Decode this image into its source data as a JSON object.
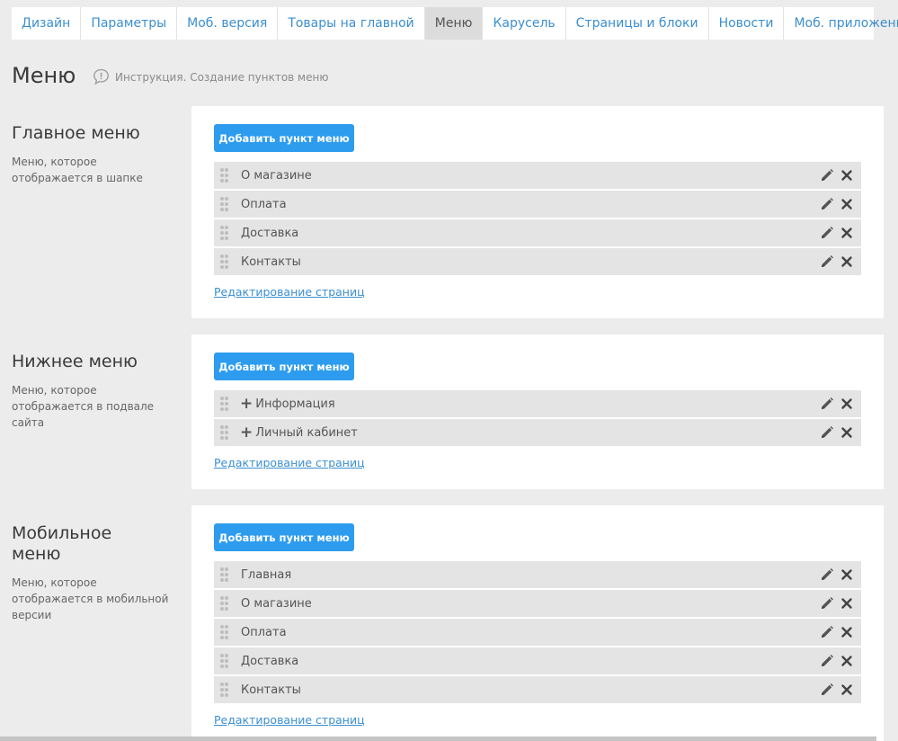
{
  "tabs": [
    {
      "label": "Дизайн",
      "active": false
    },
    {
      "label": "Параметры",
      "active": false
    },
    {
      "label": "Моб. версия",
      "active": false
    },
    {
      "label": "Товары на главной",
      "active": false
    },
    {
      "label": "Меню",
      "active": true
    },
    {
      "label": "Карусель",
      "active": false
    },
    {
      "label": "Страницы и блоки",
      "active": false
    },
    {
      "label": "Новости",
      "active": false
    },
    {
      "label": "Моб. приложение",
      "active": false
    }
  ],
  "page": {
    "title": "Меню",
    "instruction": "Инструкция. Создание пунктов меню"
  },
  "colors": {
    "accent": "#2d9cef",
    "link": "#3b8fd0",
    "background": "#ececec",
    "item_bg": "#e4e4e4"
  },
  "sections": [
    {
      "title": "Главное меню",
      "description": "Меню, которое отображается в шапке",
      "add_button": "Добавить пункт меню",
      "items": [
        {
          "label": "О магазине",
          "expandable": false
        },
        {
          "label": "Оплата",
          "expandable": false
        },
        {
          "label": "Доставка",
          "expandable": false
        },
        {
          "label": "Контакты",
          "expandable": false
        }
      ],
      "edit_pages_link": "Редактирование страниц"
    },
    {
      "title": "Нижнее меню",
      "description": "Меню, которое отображается в подвале сайта",
      "add_button": "Добавить пункт меню",
      "items": [
        {
          "label": "Информация",
          "expandable": true
        },
        {
          "label": "Личный кабинет",
          "expandable": true
        }
      ],
      "edit_pages_link": "Редактирование страниц"
    },
    {
      "title": "Мобильное меню",
      "description": "Меню, которое отображается в мобильной версии",
      "add_button": "Добавить пункт меню",
      "items": [
        {
          "label": "Главная",
          "expandable": false
        },
        {
          "label": "О магазине",
          "expandable": false
        },
        {
          "label": "Оплата",
          "expandable": false
        },
        {
          "label": "Доставка",
          "expandable": false
        },
        {
          "label": "Контакты",
          "expandable": false
        }
      ],
      "edit_pages_link": "Редактирование страниц"
    }
  ],
  "icons": {
    "drag": "drag-handle-icon",
    "edit": "pencil-icon",
    "delete": "close-icon",
    "expand": "plus-icon",
    "instruction": "speech-bubble-info-icon"
  }
}
